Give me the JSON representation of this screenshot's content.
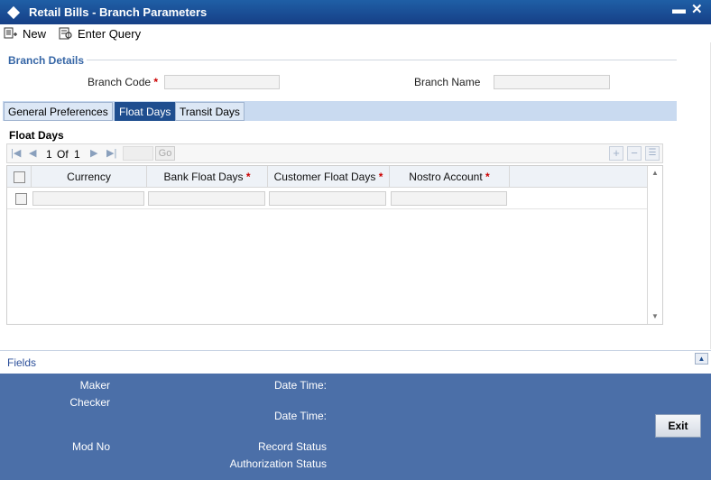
{
  "window": {
    "title": "Retail Bills - Branch Parameters",
    "minimize": "▬",
    "close": "✕"
  },
  "toolbar": {
    "new_label": "New",
    "enter_query_label": "Enter Query"
  },
  "section": {
    "title": "Branch Details"
  },
  "branch": {
    "code_label": "Branch Code",
    "code_required": "*",
    "code_value": "",
    "name_label": "Branch Name",
    "name_value": ""
  },
  "tabs": [
    {
      "label": "General Preferences",
      "active": false
    },
    {
      "label": "Float Days",
      "active": true
    },
    {
      "label": "Transit Days",
      "active": false
    }
  ],
  "float_days": {
    "title": "Float Days",
    "pager": {
      "current": "1",
      "of_label": "Of",
      "total": "1",
      "go_label": "Go"
    },
    "columns": [
      {
        "label": "Currency",
        "required": ""
      },
      {
        "label": "Bank Float Days",
        "required": "*"
      },
      {
        "label": "Customer Float Days",
        "required": "*"
      },
      {
        "label": "Nostro Account",
        "required": "*"
      }
    ]
  },
  "fields_bar": {
    "label": "Fields"
  },
  "footer": {
    "maker": "Maker",
    "checker": "Checker",
    "date_time_1": "Date Time:",
    "date_time_2": "Date Time:",
    "mod_no": "Mod No",
    "record_status": "Record Status",
    "authorization_status": "Authorization Status",
    "exit_label": "Exit"
  },
  "colors": {
    "title_bar": "#1f4e8f",
    "footer": "#4b6fa8",
    "active_tab": "#1f4e8f",
    "required": "#cc0000"
  }
}
